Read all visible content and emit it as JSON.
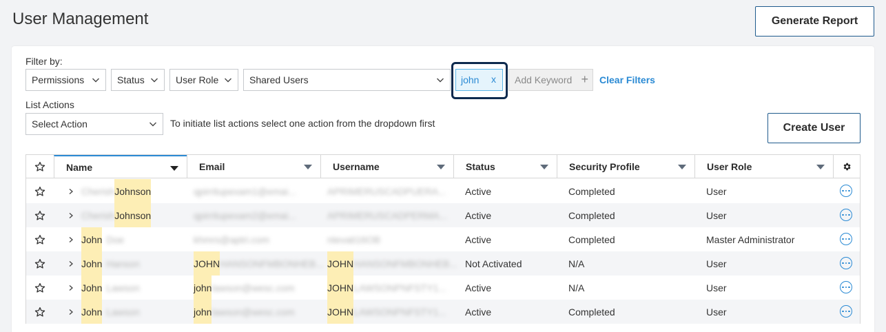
{
  "header": {
    "title": "User Management",
    "generate_report_label": "Generate Report"
  },
  "filters": {
    "label": "Filter by:",
    "permissions": "Permissions",
    "status": "Status",
    "user_role": "User Role",
    "shared_users": "Shared Users",
    "keyword_chip": "john",
    "keyword_remove": "x",
    "add_keyword_placeholder": "Add Keyword",
    "clear_filters": "Clear Filters"
  },
  "list_actions": {
    "label": "List Actions",
    "select_value": "Select Action",
    "hint": "To initiate list actions select one action from the dropdown first",
    "create_user_label": "Create User"
  },
  "table": {
    "columns": [
      "Name",
      "Email",
      "Username",
      "Status",
      "Security Profile",
      "User Role"
    ],
    "rows": [
      {
        "name_hidden": "Cherish",
        "name_match": "Johnson",
        "name_rest": "",
        "email_match": "",
        "email_hidden": "qpirritupexam1@emai...",
        "username_match": "",
        "username_hidden": "APRIMERUSCADPUERA...",
        "status": "Active",
        "security": "Completed",
        "role": "User"
      },
      {
        "name_hidden": "Cherish",
        "name_match": "Johnson",
        "name_rest": "",
        "email_match": "",
        "email_hidden": "qpirritupexam2@emai...",
        "username_match": "",
        "username_hidden": "APRIMERUSCADPERMA...",
        "status": "Active",
        "security": "Completed",
        "role": "User"
      },
      {
        "name_hidden": "",
        "name_match": "John",
        "name_rest": "Doe",
        "email_match": "",
        "email_hidden": "khmrs@aptri.com",
        "username_match": "",
        "username_hidden": "ntevati16OB",
        "status": "Active",
        "security": "Completed",
        "role": "Master Administrator"
      },
      {
        "name_hidden": "",
        "name_match": "John",
        "name_rest": "Hanson",
        "email_match": "JOHN",
        "email_hidden": "HANSONFMBONHEB...",
        "username_match": "JOHN",
        "username_hidden": "HANSONFMBONHEB...",
        "status": "Not Activated",
        "security": "N/A",
        "role": "User"
      },
      {
        "name_hidden": "",
        "name_match": "John",
        "name_rest": "Lawson",
        "email_match": "john",
        "email_hidden": "lawson@wesc.com",
        "username_match": "JOHN",
        "username_hidden": "LAWSONPNFSTY1...",
        "status": "Active",
        "security": "N/A",
        "role": "User"
      },
      {
        "name_hidden": "",
        "name_match": "John",
        "name_rest": "Lawson",
        "email_match": "john",
        "email_hidden": "lawson@wesc.com",
        "username_match": "JOHN",
        "username_hidden": "LAWSONPNFSTY1...",
        "status": "Active",
        "security": "Completed",
        "role": "User"
      }
    ]
  },
  "colors": {
    "accent": "#2a8ad4",
    "highlight": "#fdeeb5",
    "focus_ring": "#0d2a4e"
  }
}
